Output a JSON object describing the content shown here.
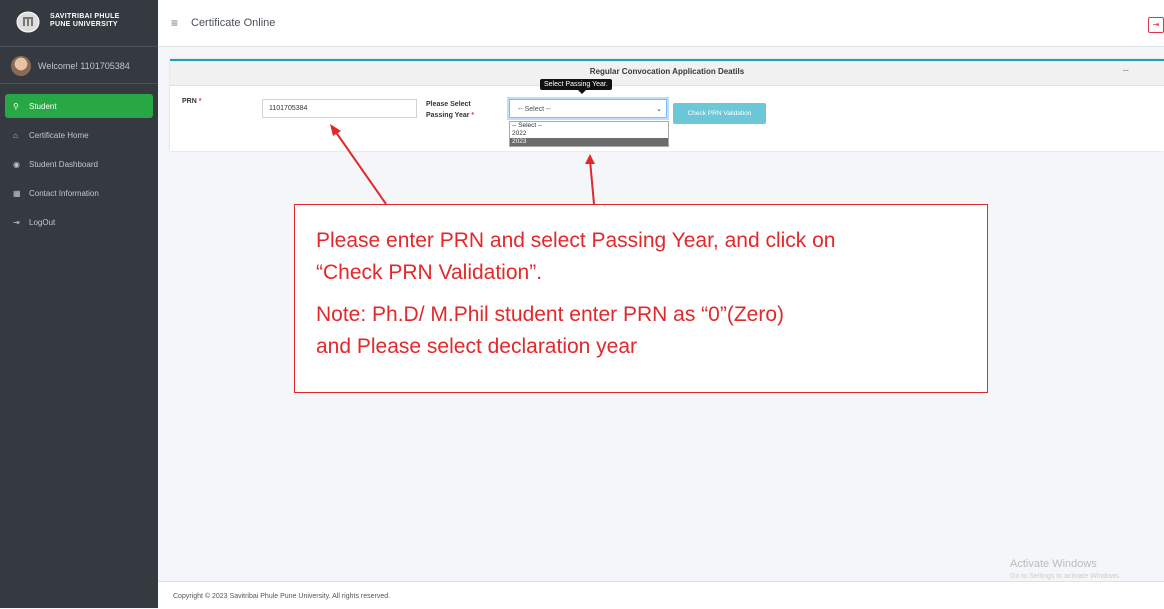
{
  "brand": {
    "line1": "SAVITRIBAI PHULE",
    "line2": "PUNE UNIVERSITY"
  },
  "user": {
    "welcome": "Welcome! 1101705384"
  },
  "sidebar": {
    "items": [
      {
        "label": "Student",
        "icon": "user-icon",
        "active": true
      },
      {
        "label": "Certificate Home",
        "icon": "home-icon"
      },
      {
        "label": "Student Dashboard",
        "icon": "dashboard-icon"
      },
      {
        "label": "Contact Information",
        "icon": "address-card-icon"
      },
      {
        "label": "LogOut",
        "icon": "sign-out-icon"
      }
    ]
  },
  "topbar": {
    "title": "Certificate Online"
  },
  "card": {
    "title": "Regular Convocation Application Deatils"
  },
  "form": {
    "prn_label": "PRN",
    "prn_value": "1101705384",
    "passing_label_line1": "Please Select",
    "passing_label_line2": "Passing Year",
    "select_value": "-- Select --",
    "options": [
      "-- Select --",
      "2022",
      "2023"
    ],
    "highlighted_option": "2023",
    "check_button": "Check PRN Validation",
    "tooltip": "Select Passing Year."
  },
  "callout": {
    "line1": "Please enter PRN and select Passing Year, and click on",
    "line2": "“Check PRN Validation”.",
    "line3": "Note: Ph.D/ M.Phil student enter PRN as “0”(Zero)",
    "line4": "and Please select declaration year"
  },
  "footer": {
    "text": "Copyright © 2023 Savitribai Phule Pune University. All rights reserved."
  },
  "watermark": {
    "title": "Activate Windows",
    "subtitle": "Go to Settings to activate Windows."
  },
  "colors": {
    "sidebar": "#343a40",
    "active": "#28a745",
    "accent": "#17a2b8",
    "callout": "#e3282b"
  }
}
